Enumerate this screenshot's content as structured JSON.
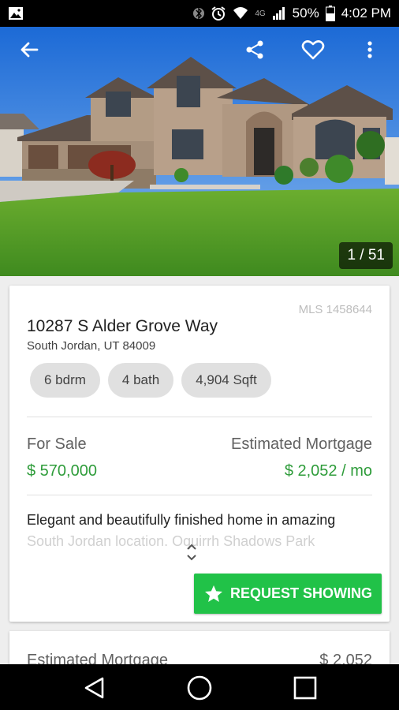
{
  "status_bar": {
    "lte_label": "4G",
    "battery": "50%",
    "time": "4:02 PM"
  },
  "photo": {
    "counter": "1 / 51"
  },
  "listing": {
    "mls": "MLS 1458644",
    "address": "10287 S Alder Grove Way",
    "city": "South Jordan, UT 84009",
    "chips": [
      "6 bdrm",
      "4 bath",
      "4,904 Sqft"
    ],
    "status_label": "For Sale",
    "price": "$ 570,000",
    "mortgage_label": "Estimated Mortgage",
    "mortgage": "$ 2,052 / mo",
    "description_line1": "Elegant and beautifully finished home in amazing",
    "description_line2": "South Jordan location. Oquirrh Shadows Park",
    "request_label": "REQUEST SHOWING"
  },
  "next_card": {
    "label": "Estimated Mortgage",
    "value": "$ 2,052"
  },
  "colors": {
    "accent_green": "#21c248",
    "price_green": "#2e9c3a"
  },
  "icons": {
    "back": "arrow-left",
    "share": "share",
    "favorite": "heart-outline",
    "more": "dots-vertical",
    "request": "star"
  }
}
